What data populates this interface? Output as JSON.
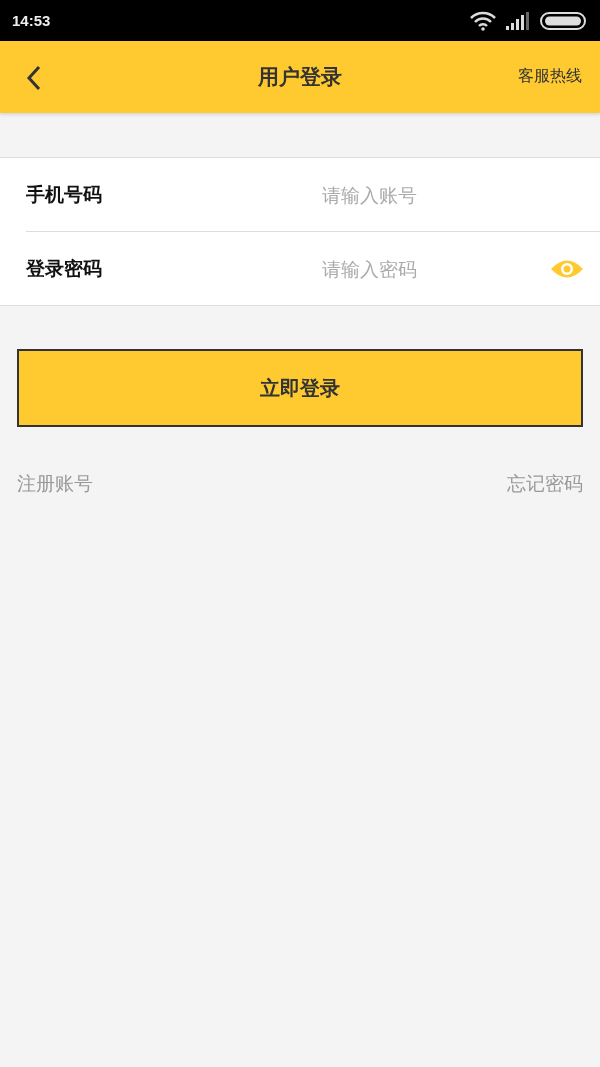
{
  "status_bar": {
    "time": "14:53"
  },
  "header": {
    "title": "用户登录",
    "action": "客服热线"
  },
  "fields": [
    {
      "kind": "text",
      "label": "手机号码",
      "placeholder": "请输入账号"
    },
    {
      "kind": "password",
      "label": "登录密码",
      "placeholder": "请输入密码"
    }
  ],
  "login_button": "立即登录",
  "links": [
    "注册账号",
    "忘记密码"
  ]
}
